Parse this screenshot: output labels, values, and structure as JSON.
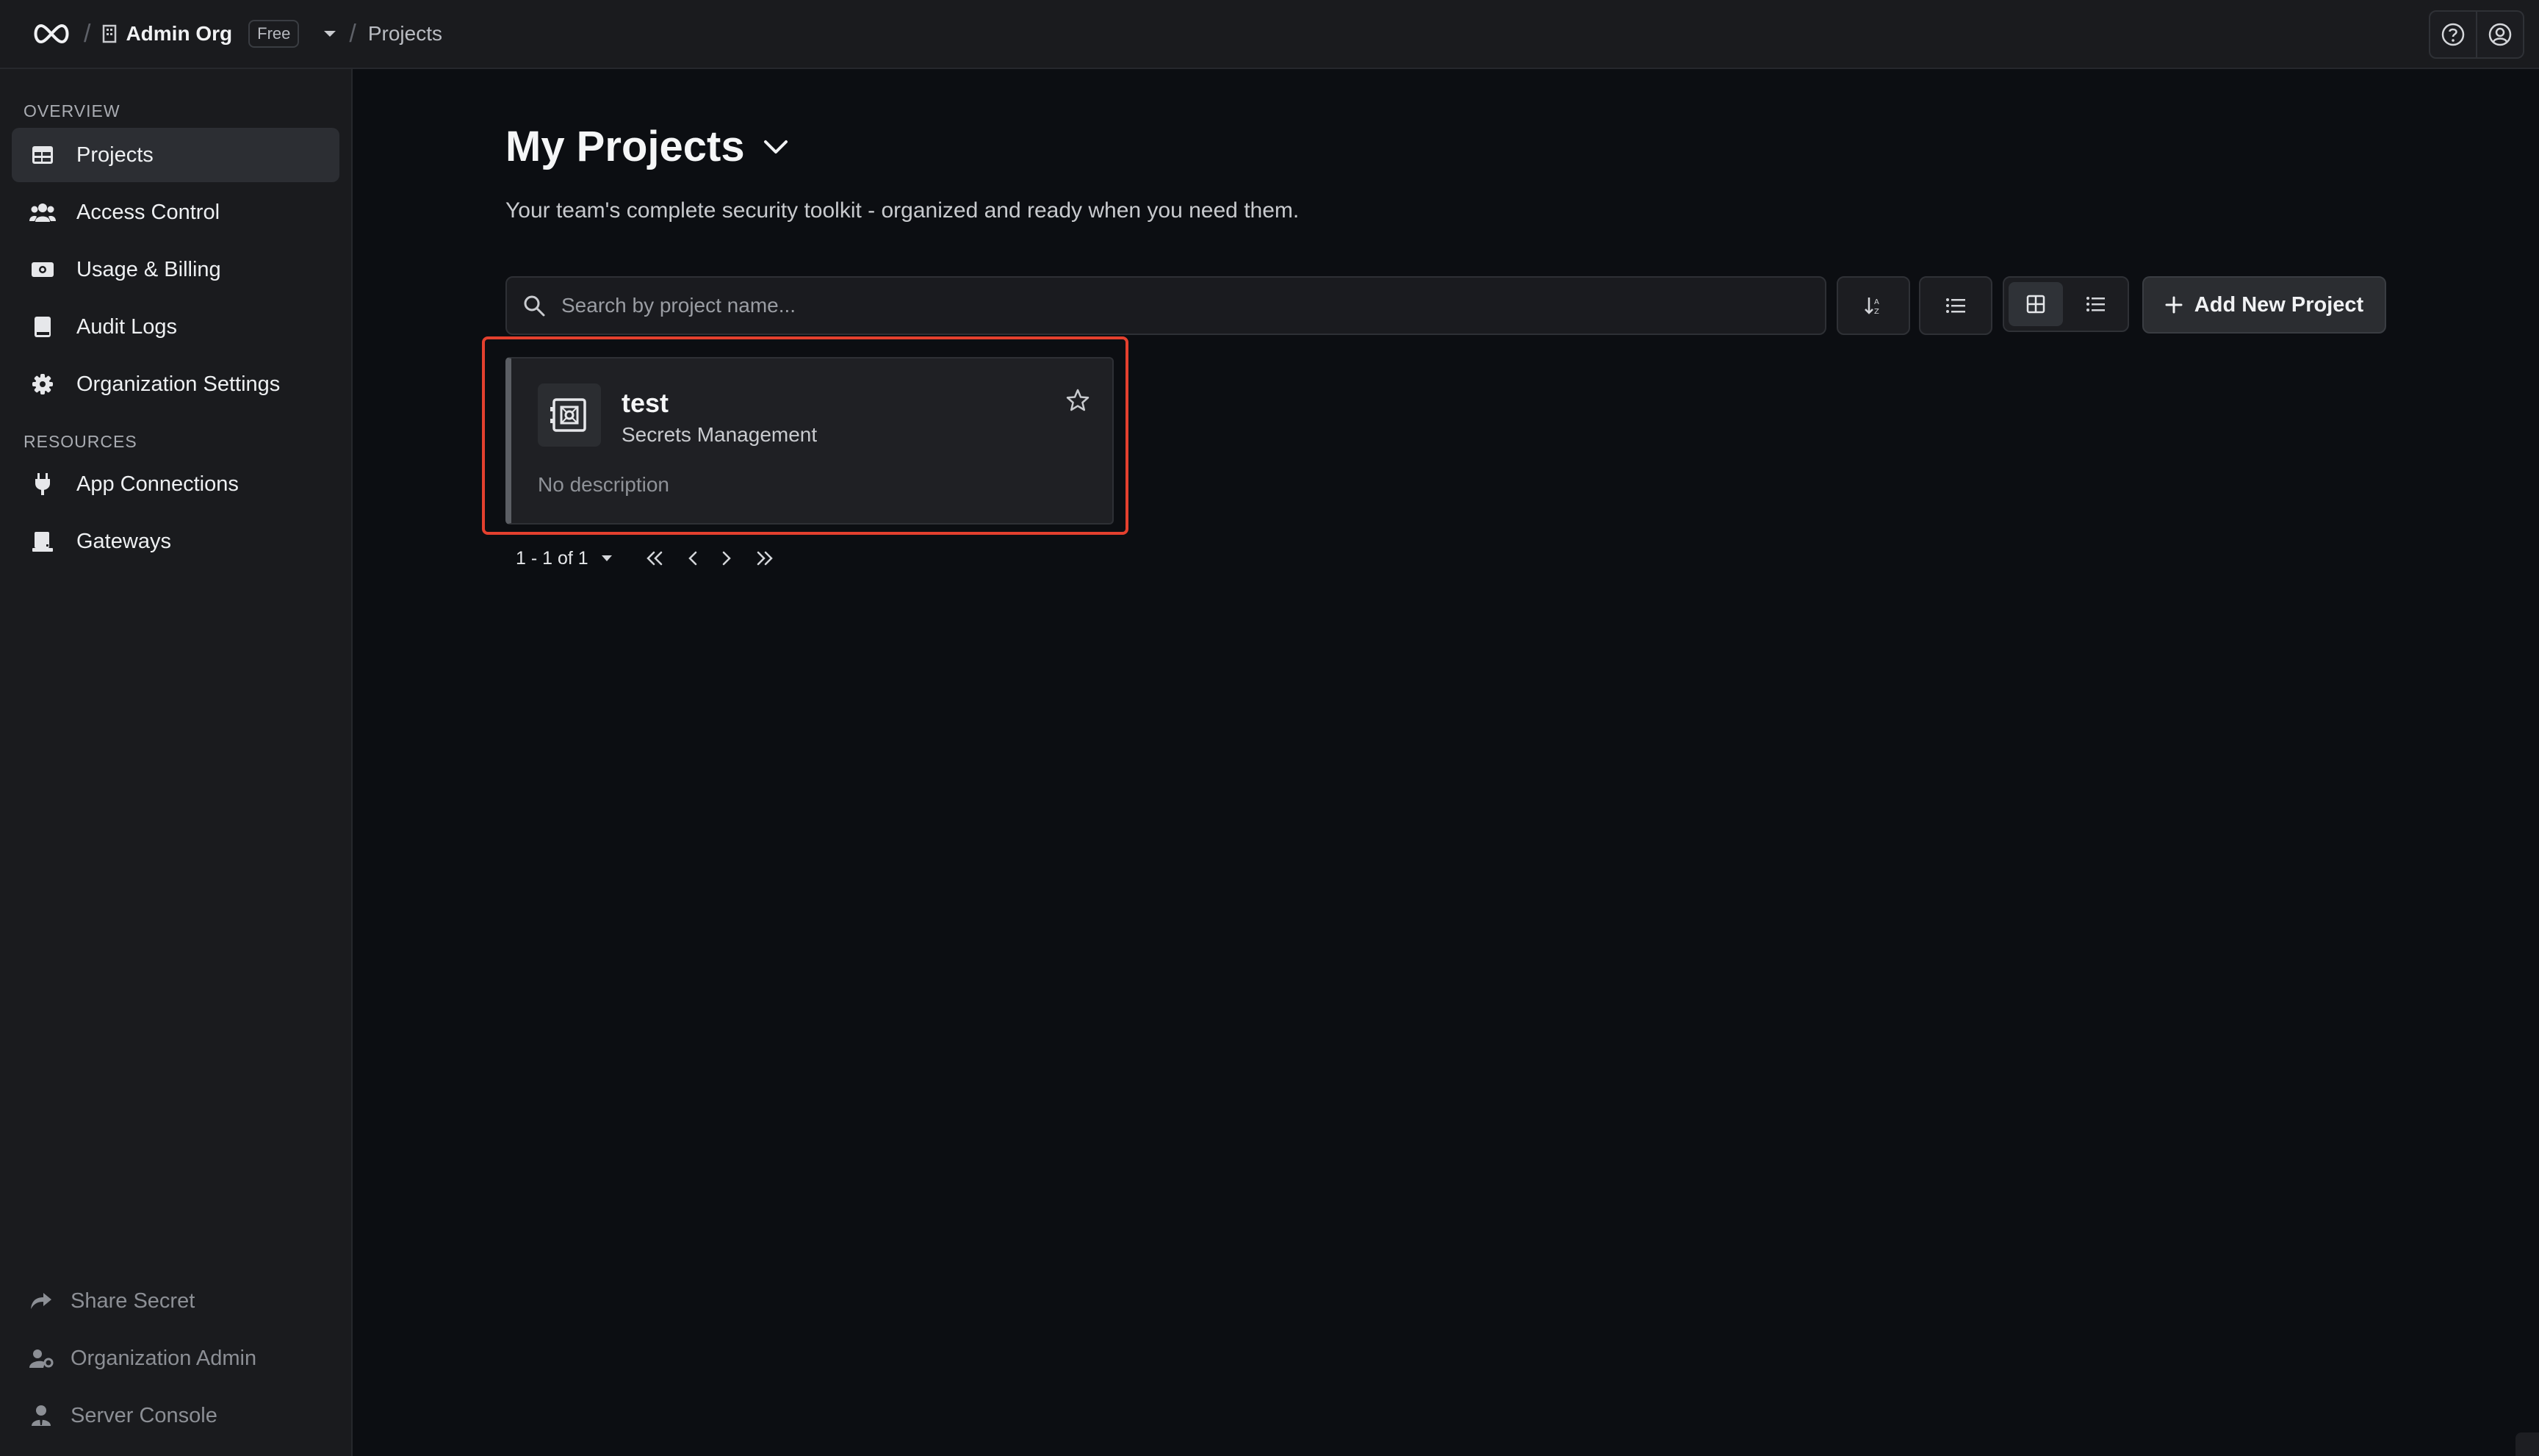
{
  "topbar": {
    "org_name": "Admin Org",
    "plan_badge": "Free",
    "breadcrumb_page": "Projects",
    "separator": "/"
  },
  "sidebar": {
    "overview_label": "OVERVIEW",
    "resources_label": "RESOURCES",
    "items": [
      {
        "label": "Projects"
      },
      {
        "label": "Access Control"
      },
      {
        "label": "Usage & Billing"
      },
      {
        "label": "Audit Logs"
      },
      {
        "label": "Organization Settings"
      }
    ],
    "resource_items": [
      {
        "label": "App Connections"
      },
      {
        "label": "Gateways"
      }
    ],
    "bottom_items": [
      {
        "label": "Share Secret"
      },
      {
        "label": "Organization Admin"
      },
      {
        "label": "Server Console"
      }
    ]
  },
  "main": {
    "title": "My Projects",
    "subtitle": "Your team's complete security toolkit - organized and ready when you need them.",
    "search_placeholder": "Search by project name...",
    "add_button": "Add New Project",
    "projects": [
      {
        "name": "test",
        "type": "Secrets Management",
        "description": "No description"
      }
    ],
    "pagination": {
      "range": "1 - 1 of 1"
    }
  },
  "colors": {
    "background": "#0c0e12",
    "sidebar": "#1a1b1e",
    "highlight": "#e4402e"
  }
}
